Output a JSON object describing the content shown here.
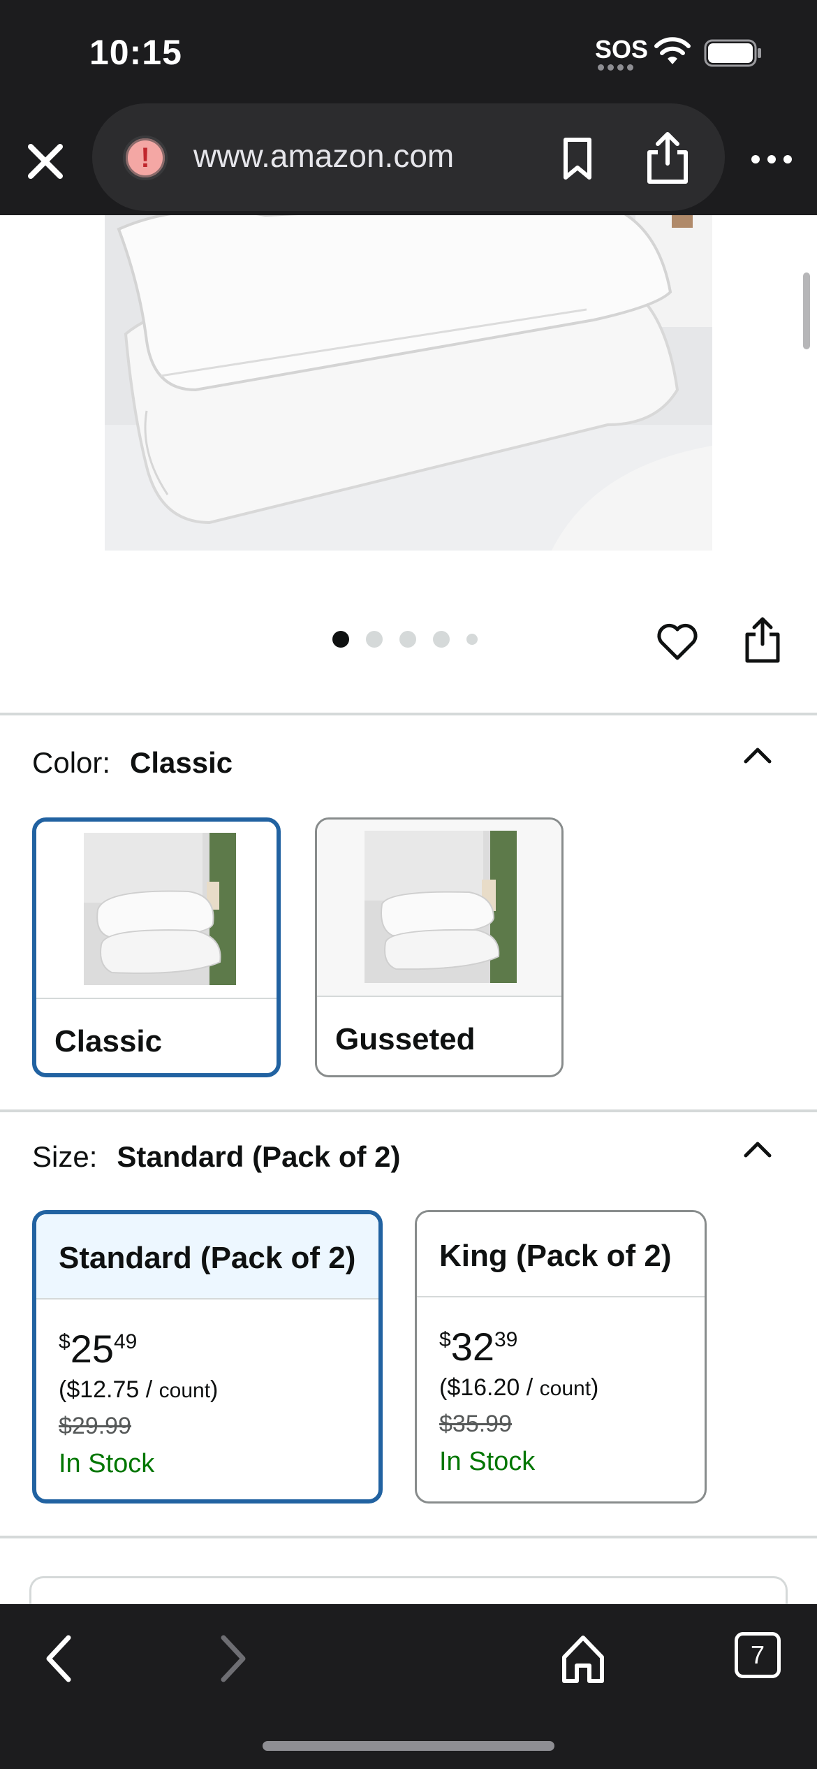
{
  "status_bar": {
    "time": "10:15",
    "sos": "SOS"
  },
  "browser": {
    "url": "www.amazon.com",
    "warning_icon": "!",
    "icons": [
      "close-icon",
      "security-warning-icon",
      "bookmark-icon",
      "share-icon",
      "more-icon"
    ]
  },
  "product": {
    "carousel": {
      "count": 5,
      "active_index": 0
    }
  },
  "color": {
    "label": "Color:",
    "selected": "Classic",
    "options": [
      {
        "label": "Classic",
        "selected": true
      },
      {
        "label": "Gusseted",
        "selected": false
      }
    ]
  },
  "size": {
    "label": "Size:",
    "selected": "Standard (Pack of 2)",
    "options": [
      {
        "label": "Standard (Pack of 2)",
        "currency": "$",
        "whole": "25",
        "cents": "49",
        "per_unit": "($12.75 / ",
        "unit": "count",
        "per_unit_close": ")",
        "list_price": "$29.99",
        "stock": "In Stock",
        "selected": true
      },
      {
        "label": "King (Pack of 2)",
        "currency": "$",
        "whole": "32",
        "cents": "39",
        "per_unit": "($16.20 / ",
        "unit": "count",
        "per_unit_close": ")",
        "list_price": "$35.99",
        "stock": "In Stock",
        "selected": false
      }
    ]
  },
  "toolbar": {
    "tabs_count": "7"
  },
  "colors": {
    "chrome": "#1c1c1e",
    "selected_border": "#2162a1",
    "in_stock": "#007600",
    "selected_head": "#edf7ff"
  }
}
